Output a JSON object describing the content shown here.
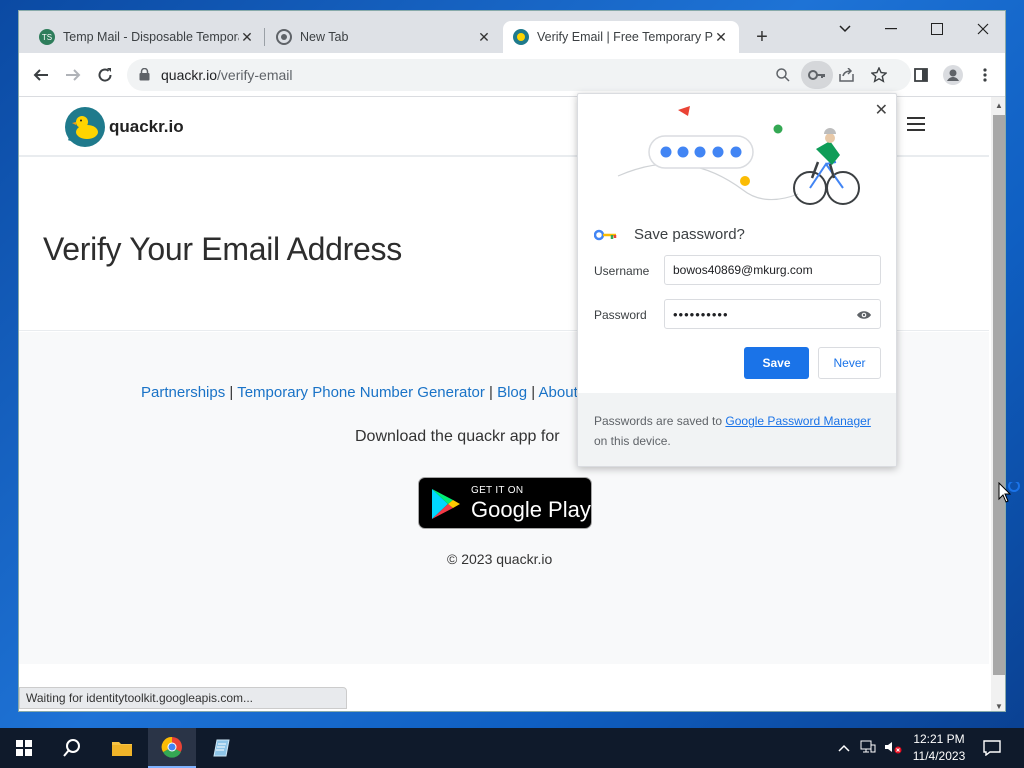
{
  "browser": {
    "tabs": [
      {
        "title": "Temp Mail - Disposable Temporary",
        "favicon": "tempmail-favicon",
        "active": false
      },
      {
        "title": "New Tab",
        "favicon": "chrome-favicon",
        "active": false
      },
      {
        "title": "Verify Email | Free Temporary Phone",
        "favicon": "quackr-favicon",
        "active": true
      }
    ],
    "address": {
      "domain": "quackr.io",
      "path": "/verify-email"
    },
    "status_text": "Waiting for identitytoolkit.googleapis.com..."
  },
  "site": {
    "logo_text": "quackr.io",
    "heading": "Verify Your Email Address",
    "footer": {
      "links": [
        "Partnerships",
        "Temporary Phone Number Generator",
        "Blog",
        "About"
      ],
      "separator": "|",
      "download_text": "Download the quackr app for",
      "gplay_small": "GET IT ON",
      "gplay_big": "Google Play",
      "copyright": "© 2023 quackr.io"
    }
  },
  "password_popup": {
    "title": "Save password?",
    "username_label": "Username",
    "username_value": "bowos40869@mkurg.com",
    "password_label": "Password",
    "password_value": "••••••••••",
    "save_label": "Save",
    "never_label": "Never",
    "footer_prefix": "Passwords are saved to",
    "footer_link": "Google Password Manager",
    "footer_suffix": "on this device."
  },
  "taskbar": {
    "time": "12:21 PM",
    "date": "11/4/2023"
  },
  "colors": {
    "accent": "#1a73e8",
    "link": "#1a73c7",
    "taskbar": "#0f1a2b"
  }
}
